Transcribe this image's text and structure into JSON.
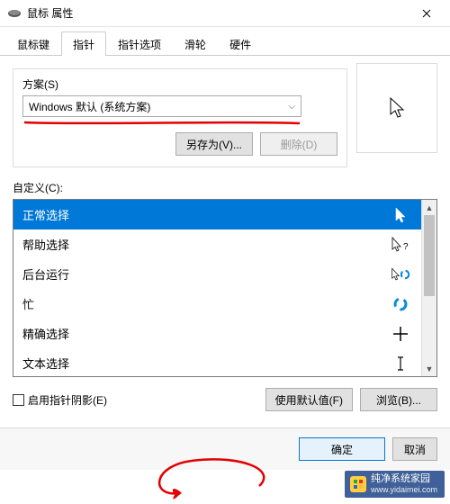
{
  "window": {
    "title": "鼠标 属性"
  },
  "tabs": [
    {
      "label": "鼠标键",
      "active": false
    },
    {
      "label": "指针",
      "active": true
    },
    {
      "label": "指针选项",
      "active": false
    },
    {
      "label": "滑轮",
      "active": false
    },
    {
      "label": "硬件",
      "active": false
    }
  ],
  "scheme": {
    "group_label": "方案(S)",
    "selected": "Windows 默认 (系统方案)",
    "save_as_label": "另存为(V)...",
    "delete_label": "删除(D)"
  },
  "customize": {
    "label": "自定义(C):",
    "items": [
      {
        "name": "正常选择",
        "cursor": "arrow",
        "selected": true
      },
      {
        "name": "帮助选择",
        "cursor": "help",
        "selected": false
      },
      {
        "name": "后台运行",
        "cursor": "busy-arrow",
        "selected": false
      },
      {
        "name": "忙",
        "cursor": "busy",
        "selected": false
      },
      {
        "name": "精确选择",
        "cursor": "cross",
        "selected": false
      },
      {
        "name": "文本选择",
        "cursor": "ibeam",
        "selected": false
      }
    ]
  },
  "options": {
    "shadow_checkbox_label": "启用指针阴影(E)",
    "shadow_checked": false,
    "use_default_label": "使用默认值(F)",
    "browse_label": "浏览(B)..."
  },
  "footer": {
    "ok_label": "确定",
    "cancel_label": "取消"
  },
  "watermark": {
    "brand": "纯净系统家园",
    "url": "www.yidaimei.com"
  },
  "colors": {
    "selection": "#0078d7",
    "annotation_red": "#e20000",
    "busy_ring": "#0a8cd6"
  }
}
